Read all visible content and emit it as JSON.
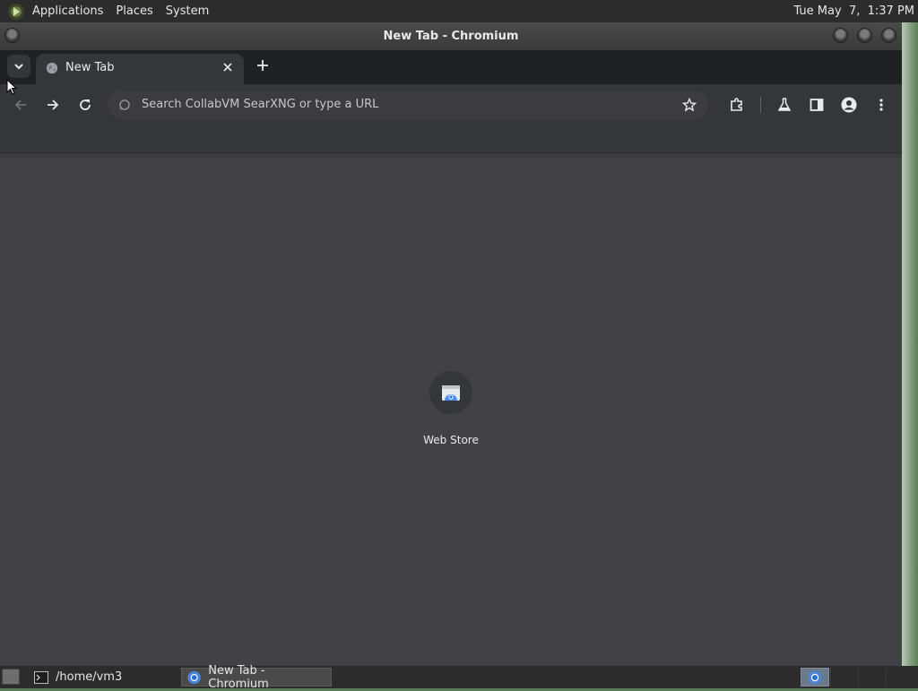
{
  "top_panel": {
    "menus": [
      "Applications",
      "Places",
      "System"
    ],
    "clock": "Tue May  7,  1:37 PM"
  },
  "window": {
    "title": "New Tab - Chromium"
  },
  "browser": {
    "tab": {
      "title": "New Tab"
    },
    "omnibox": {
      "placeholder": "Search CollabVM SearXNG or type a URL"
    },
    "shortcuts": [
      {
        "label": "Web Store",
        "icon": "web-store-icon"
      }
    ]
  },
  "taskbar": {
    "tasks": [
      {
        "label": "/home/vm3",
        "icon": "terminal-icon",
        "active": false
      },
      {
        "label": "New Tab - Chromium",
        "icon": "chromium-icon",
        "active": true
      }
    ]
  },
  "colors": {
    "panel": "#2c2c2c",
    "tabstrip": "#202124",
    "toolbar": "#35363a",
    "content": "#424246",
    "text": "#e8eaed"
  }
}
